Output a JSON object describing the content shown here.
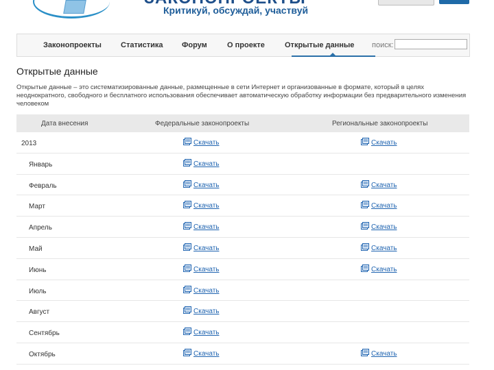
{
  "header": {
    "site_title": "ЗАКОНОПРОЕКТЫ",
    "tagline": "Критикуй, обсуждай, участвуй"
  },
  "nav": {
    "items": [
      "Законопроекты",
      "Статистика",
      "Форум",
      "О проекте",
      "Открытые данные"
    ],
    "active": "Открытые данные",
    "search_label": "поиск:",
    "search_value": ""
  },
  "page": {
    "title": "Открытые данные",
    "description": "Открытые данные – это систематизированные данные, размещенные в сети Интернет и организованные в формате, который в целях неоднократного, свободного и бесплатного использования обеспечивает автоматическую обработку информации без предварительного изменения человеком"
  },
  "table": {
    "headers": [
      "Дата внесения",
      "Федеральные законопроекты",
      "Региональные законопроекты"
    ],
    "download_label": "Скачать",
    "rows": [
      {
        "label": "2013",
        "federal": true,
        "regional": true
      },
      {
        "label": "Январь",
        "federal": true,
        "regional": false
      },
      {
        "label": "Февраль",
        "federal": true,
        "regional": true
      },
      {
        "label": "Март",
        "federal": true,
        "regional": true
      },
      {
        "label": "Апрель",
        "federal": true,
        "regional": true
      },
      {
        "label": "Май",
        "federal": true,
        "regional": true
      },
      {
        "label": "Июнь",
        "federal": true,
        "regional": true
      },
      {
        "label": "Июль",
        "federal": true,
        "regional": false
      },
      {
        "label": "Август",
        "federal": true,
        "regional": false
      },
      {
        "label": "Сентябрь",
        "federal": true,
        "regional": false
      },
      {
        "label": "Октябрь",
        "federal": true,
        "regional": true
      }
    ]
  },
  "colors": {
    "link": "#1e63b0",
    "nav_active": "#2a6fa8",
    "header_blue": "#1e4f8a"
  }
}
